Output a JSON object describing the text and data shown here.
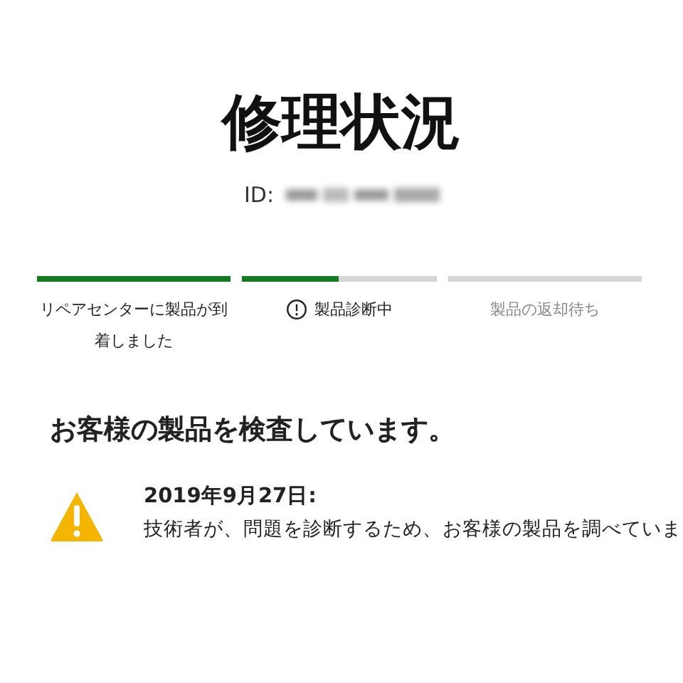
{
  "page": {
    "title": "修理状況",
    "id_label": "ID:"
  },
  "steps": [
    {
      "label": "リペアセンターに製品が到着しました",
      "level": 1,
      "kind": "done"
    },
    {
      "label": "製品診断中",
      "level": 0.5,
      "kind": "current"
    },
    {
      "label": "製品の返却待ち",
      "level": 0,
      "kind": "pending"
    }
  ],
  "status_heading": "お客様の製品を検査しています。",
  "update": {
    "kind": "warning",
    "date": "2019年9月27日:",
    "message": "技術者が、問題を診断するため、お客様の製品を調べていま"
  }
}
